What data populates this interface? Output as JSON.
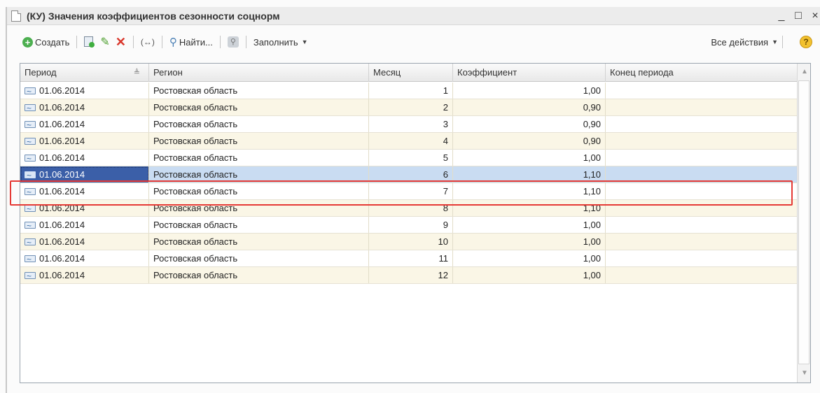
{
  "window": {
    "title": "(КУ) Значения коэффициентов сезонности соцнорм",
    "minimize": "_",
    "maximize": "□",
    "close": "×"
  },
  "toolbar": {
    "create_label": "Создать",
    "find_label": "Найти...",
    "fill_label": "Заполнить",
    "all_actions_label": "Все действия",
    "arrows_label": "(↔)",
    "help_label": "?"
  },
  "table": {
    "columns": [
      "Период",
      "Регион",
      "Месяц",
      "Коэффициент",
      "Конец периода"
    ],
    "rows": [
      {
        "period": "01.06.2014",
        "region": "Ростовская область",
        "month": "1",
        "coef": "1,00",
        "end": ""
      },
      {
        "period": "01.06.2014",
        "region": "Ростовская область",
        "month": "2",
        "coef": "0,90",
        "end": ""
      },
      {
        "period": "01.06.2014",
        "region": "Ростовская область",
        "month": "3",
        "coef": "0,90",
        "end": ""
      },
      {
        "period": "01.06.2014",
        "region": "Ростовская область",
        "month": "4",
        "coef": "0,90",
        "end": ""
      },
      {
        "period": "01.06.2014",
        "region": "Ростовская область",
        "month": "5",
        "coef": "1,00",
        "end": ""
      },
      {
        "period": "01.06.2014",
        "region": "Ростовская область",
        "month": "6",
        "coef": "1,10",
        "end": ""
      },
      {
        "period": "01.06.2014",
        "region": "Ростовская область",
        "month": "7",
        "coef": "1,10",
        "end": ""
      },
      {
        "period": "01.06.2014",
        "region": "Ростовская область",
        "month": "8",
        "coef": "1,10",
        "end": ""
      },
      {
        "period": "01.06.2014",
        "region": "Ростовская область",
        "month": "9",
        "coef": "1,00",
        "end": ""
      },
      {
        "period": "01.06.2014",
        "region": "Ростовская область",
        "month": "10",
        "coef": "1,00",
        "end": ""
      },
      {
        "period": "01.06.2014",
        "region": "Ростовская область",
        "month": "11",
        "coef": "1,00",
        "end": ""
      },
      {
        "period": "01.06.2014",
        "region": "Ростовская область",
        "month": "12",
        "coef": "1,00",
        "end": ""
      }
    ],
    "selected_row": 5
  },
  "colors": {
    "selection": "#c9dcf2",
    "selected_cell": "#3b5fa8",
    "highlight_border": "#e53935",
    "alt_row": "#faf6e6"
  }
}
